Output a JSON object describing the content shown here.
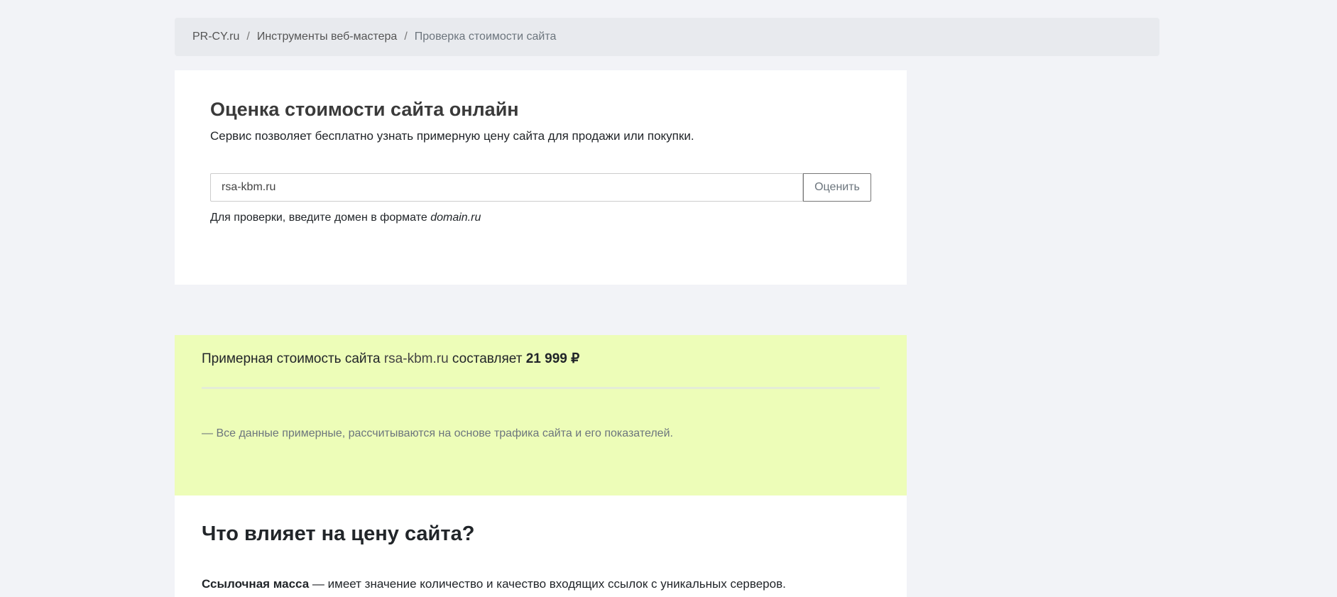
{
  "breadcrumb": {
    "items": [
      "PR-CY.ru",
      "Инструменты веб-мастера",
      "Проверка стоимости сайта"
    ],
    "separator": "/"
  },
  "form": {
    "title": "Оценка стоимости сайта онлайн",
    "subtitle": "Сервис позволяет бесплатно узнать примерную цену сайта для продажи или покупки.",
    "input_value": "rsa-kbm.ru",
    "button_label": "Оценить",
    "hint_prefix": "Для проверки, введите домен в формате ",
    "hint_example": "domain.ru"
  },
  "result": {
    "prefix": "Примерная стоимость сайта ",
    "domain": "rsa-kbm.ru",
    "middle": " составляет ",
    "price": "21 999 ₽",
    "note": "— Все данные примерные, рассчитываются на основе трафика сайта и его показателей.",
    "bg_color": "#edfdb8"
  },
  "info": {
    "title": "Что влияет на цену сайта?",
    "items": [
      {
        "term": "Ссылочная масса",
        "text": " — имеет значение количество и качество входящих ссылок с уникальных серверов."
      }
    ]
  }
}
